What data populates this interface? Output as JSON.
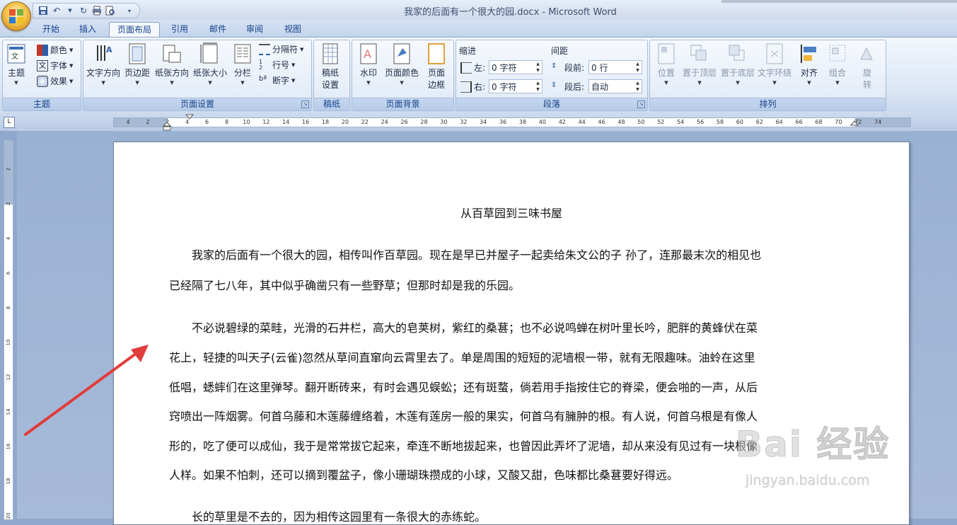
{
  "window": {
    "title": "我家的后面有一个很大的园.docx - Microsoft Word"
  },
  "tabs": [
    "开始",
    "插入",
    "页面布局",
    "引用",
    "邮件",
    "审阅",
    "视图"
  ],
  "active_tab": "页面布局",
  "ribbon": {
    "theme_group": {
      "label": "主题",
      "theme_btn": "主题",
      "colors": "颜色",
      "fonts": "字体",
      "effects": "效果"
    },
    "page_setup": {
      "label": "页面设置",
      "text_direction": "文字方向",
      "margins": "页边距",
      "orientation": "纸张方向",
      "size": "纸张大小",
      "columns": "分栏",
      "breaks": "分隔符",
      "line_numbers": "行号",
      "hyphenation": "断字"
    },
    "draft": {
      "label": "稿纸",
      "draft_settings_1": "稿纸",
      "draft_settings_2": "设置"
    },
    "page_background": {
      "label": "页面背景",
      "watermark": "水印",
      "page_color": "页面颜色",
      "page_borders_1": "页面",
      "page_borders_2": "边框"
    },
    "paragraph": {
      "label": "段落",
      "indent": "缩进",
      "spacing": "间距",
      "left_label": "左:",
      "right_label": "右:",
      "before_label": "段前:",
      "after_label": "段后:",
      "left_value": "0 字符",
      "right_value": "0 字符",
      "before_value": "0 行",
      "after_value": "自动"
    },
    "arrange": {
      "label": "排列",
      "position": "位置",
      "bring_front": "置于顶层",
      "send_back": "置于底层",
      "text_wrap": "文字环绕",
      "align": "对齐",
      "group": "组合",
      "rotate_1": "旋",
      "rotate_2": "转"
    }
  },
  "ruler": {
    "corner": "L",
    "h_ticks": [
      "4",
      "2",
      "2",
      "4",
      "6",
      "8",
      "10",
      "12",
      "14",
      "16",
      "18",
      "20",
      "22",
      "24",
      "26",
      "28",
      "30",
      "32",
      "34",
      "36",
      "38",
      "40",
      "42",
      "44",
      "46",
      "48",
      "50",
      "52",
      "54",
      "56",
      "58",
      "60",
      "62",
      "64",
      "66",
      "68",
      "70",
      "72",
      "74"
    ],
    "v_ticks": [
      "2",
      "2",
      "4",
      "6",
      "8",
      "10",
      "12",
      "14",
      "16",
      "18",
      "20"
    ]
  },
  "document": {
    "title": "从百草园到三味书屋",
    "lines": [
      "　　我家的后面有一个很大的园，相传叫作百草园。现在是早已并屋子一起卖给朱文公的子 孙了，连那最末次的相见也",
      "已经隔了七八年，其中似乎确凿只有一些野草；但那时却是我的乐园。",
      "　　不必说碧绿的菜畦，光滑的石井栏，高大的皂荚树，紫红的桑葚；也不必说鸣蝉在树叶里长吟，肥胖的黄蜂伏在菜",
      "花上，轻捷的叫天子(云雀)忽然从草间直窜向云霄里去了。单是周围的短短的泥墙根一带，就有无限趣味。油蛉在这里",
      "低唱，蟋蟀们在这里弹琴。翻开断砖来，有时会遇见蜈蚣；还有斑蝥，倘若用手指按住它的脊梁，便会啪的一声，从后",
      "窍喷出一阵烟雾。何首乌藤和木莲藤缠络着，木莲有莲房一般的果实，何首乌有臃肿的根。有人说，何首乌根是有像人",
      "形的，吃了便可以成仙，我于是常常拔它起来，牵连不断地拔起来，也曾因此弄坏了泥墙，却从来没有见过有一块根像",
      "人样。如果不怕刺，还可以摘到覆盆子，像小珊瑚珠攒成的小球，又酸又甜，色味都比桑葚要好得远。",
      "　　长的草里是不去的，因为相传这园里有一条很大的赤练蛇。"
    ]
  },
  "watermark": {
    "brand": "Bai 经验",
    "url": "jingyan.baidu.com"
  },
  "colors": {
    "arrow": "#e23b3b",
    "tab_text": "#15428b"
  }
}
